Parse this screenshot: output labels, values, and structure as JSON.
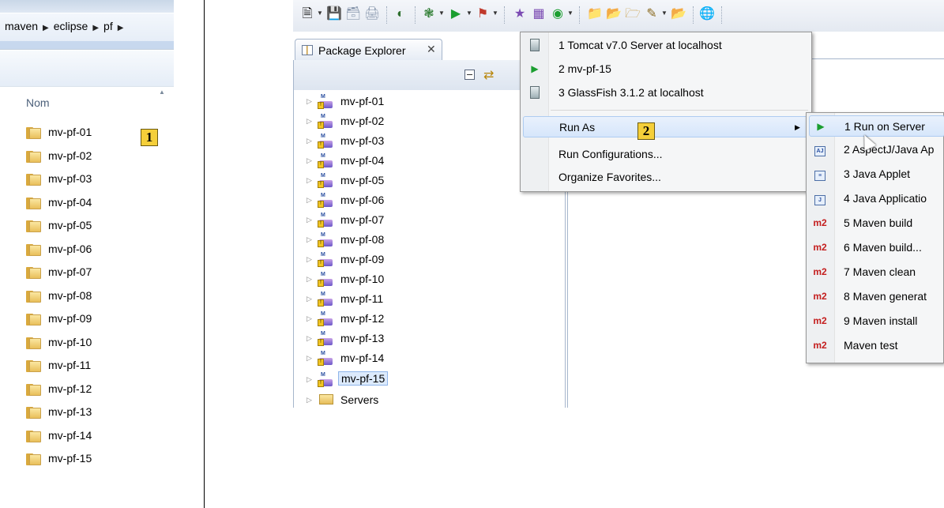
{
  "explorer": {
    "breadcrumb": [
      "maven",
      "eclipse",
      "pf"
    ],
    "column_header": "Nom",
    "folders": [
      "mv-pf-01",
      "mv-pf-02",
      "mv-pf-03",
      "mv-pf-04",
      "mv-pf-05",
      "mv-pf-06",
      "mv-pf-07",
      "mv-pf-08",
      "mv-pf-09",
      "mv-pf-10",
      "mv-pf-11",
      "mv-pf-12",
      "mv-pf-13",
      "mv-pf-14",
      "mv-pf-15"
    ],
    "badge": "1"
  },
  "eclipse": {
    "view_tab": "Package Explorer",
    "close_glyph": "✕",
    "projects": [
      "mv-pf-01",
      "mv-pf-02",
      "mv-pf-03",
      "mv-pf-04",
      "mv-pf-05",
      "mv-pf-06",
      "mv-pf-07",
      "mv-pf-08",
      "mv-pf-09",
      "mv-pf-10",
      "mv-pf-11",
      "mv-pf-12",
      "mv-pf-13",
      "mv-pf-14",
      "mv-pf-15"
    ],
    "selected_project": "mv-pf-15",
    "servers_folder": "Servers",
    "run_menu": {
      "history": [
        "1 Tomcat v7.0 Server at localhost",
        "2 mv-pf-15",
        "3 GlassFish 3.1.2 at localhost"
      ],
      "run_as": "Run As",
      "run_configurations": "Run Configurations...",
      "organize_favorites": "Organize Favorites..."
    },
    "badge": "2",
    "run_as_menu": [
      {
        "icon": "server-icon",
        "label": "1 Run on Server"
      },
      {
        "icon": "aspectj-icon",
        "label": "2 AspectJ/Java Ap"
      },
      {
        "icon": "applet-icon",
        "label": "3 Java Applet"
      },
      {
        "icon": "java-app-icon",
        "label": "4 Java Applicatio"
      },
      {
        "icon": "m2-icon",
        "label": "5 Maven build"
      },
      {
        "icon": "m2-icon",
        "label": "6 Maven build..."
      },
      {
        "icon": "m2-icon",
        "label": "7 Maven clean"
      },
      {
        "icon": "m2-icon",
        "label": "8 Maven generat"
      },
      {
        "icon": "m2-icon",
        "label": "9 Maven install"
      },
      {
        "icon": "m2-icon",
        "label": "Maven test"
      }
    ],
    "m2_text": "m2",
    "colors": {
      "menu_bg": "#f5f6f7",
      "highlight": "#d6e6fb",
      "m2": "#c41e1e",
      "badge": "#f5cf3a"
    }
  }
}
